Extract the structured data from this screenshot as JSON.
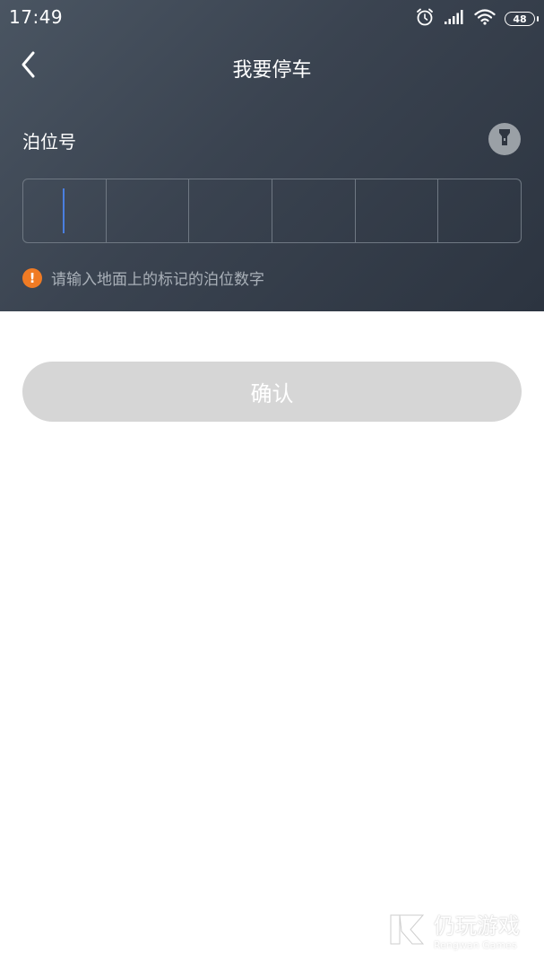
{
  "status_bar": {
    "time": "17:49",
    "battery": "48",
    "icons": [
      "alarm-icon",
      "signal-icon",
      "wifi-icon",
      "battery-icon"
    ]
  },
  "header": {
    "title": "我要停车",
    "back_icon": "chevron-left-icon"
  },
  "form": {
    "label": "泊位号",
    "flashlight_icon": "flashlight-icon",
    "code_cells": [
      "",
      "",
      "",
      "",
      "",
      ""
    ],
    "hint_icon": "exclamation-icon",
    "hint": "请输入地面上的标记的泊位数字"
  },
  "actions": {
    "confirm_label": "确认"
  },
  "watermark": {
    "title": "仍玩游戏",
    "subtitle": "Rengwan Games"
  },
  "colors": {
    "header_bg": "#3a4350",
    "accent_caret": "#4a7fe0",
    "warning": "#f07b24",
    "button_disabled": "#d6d6d6"
  }
}
